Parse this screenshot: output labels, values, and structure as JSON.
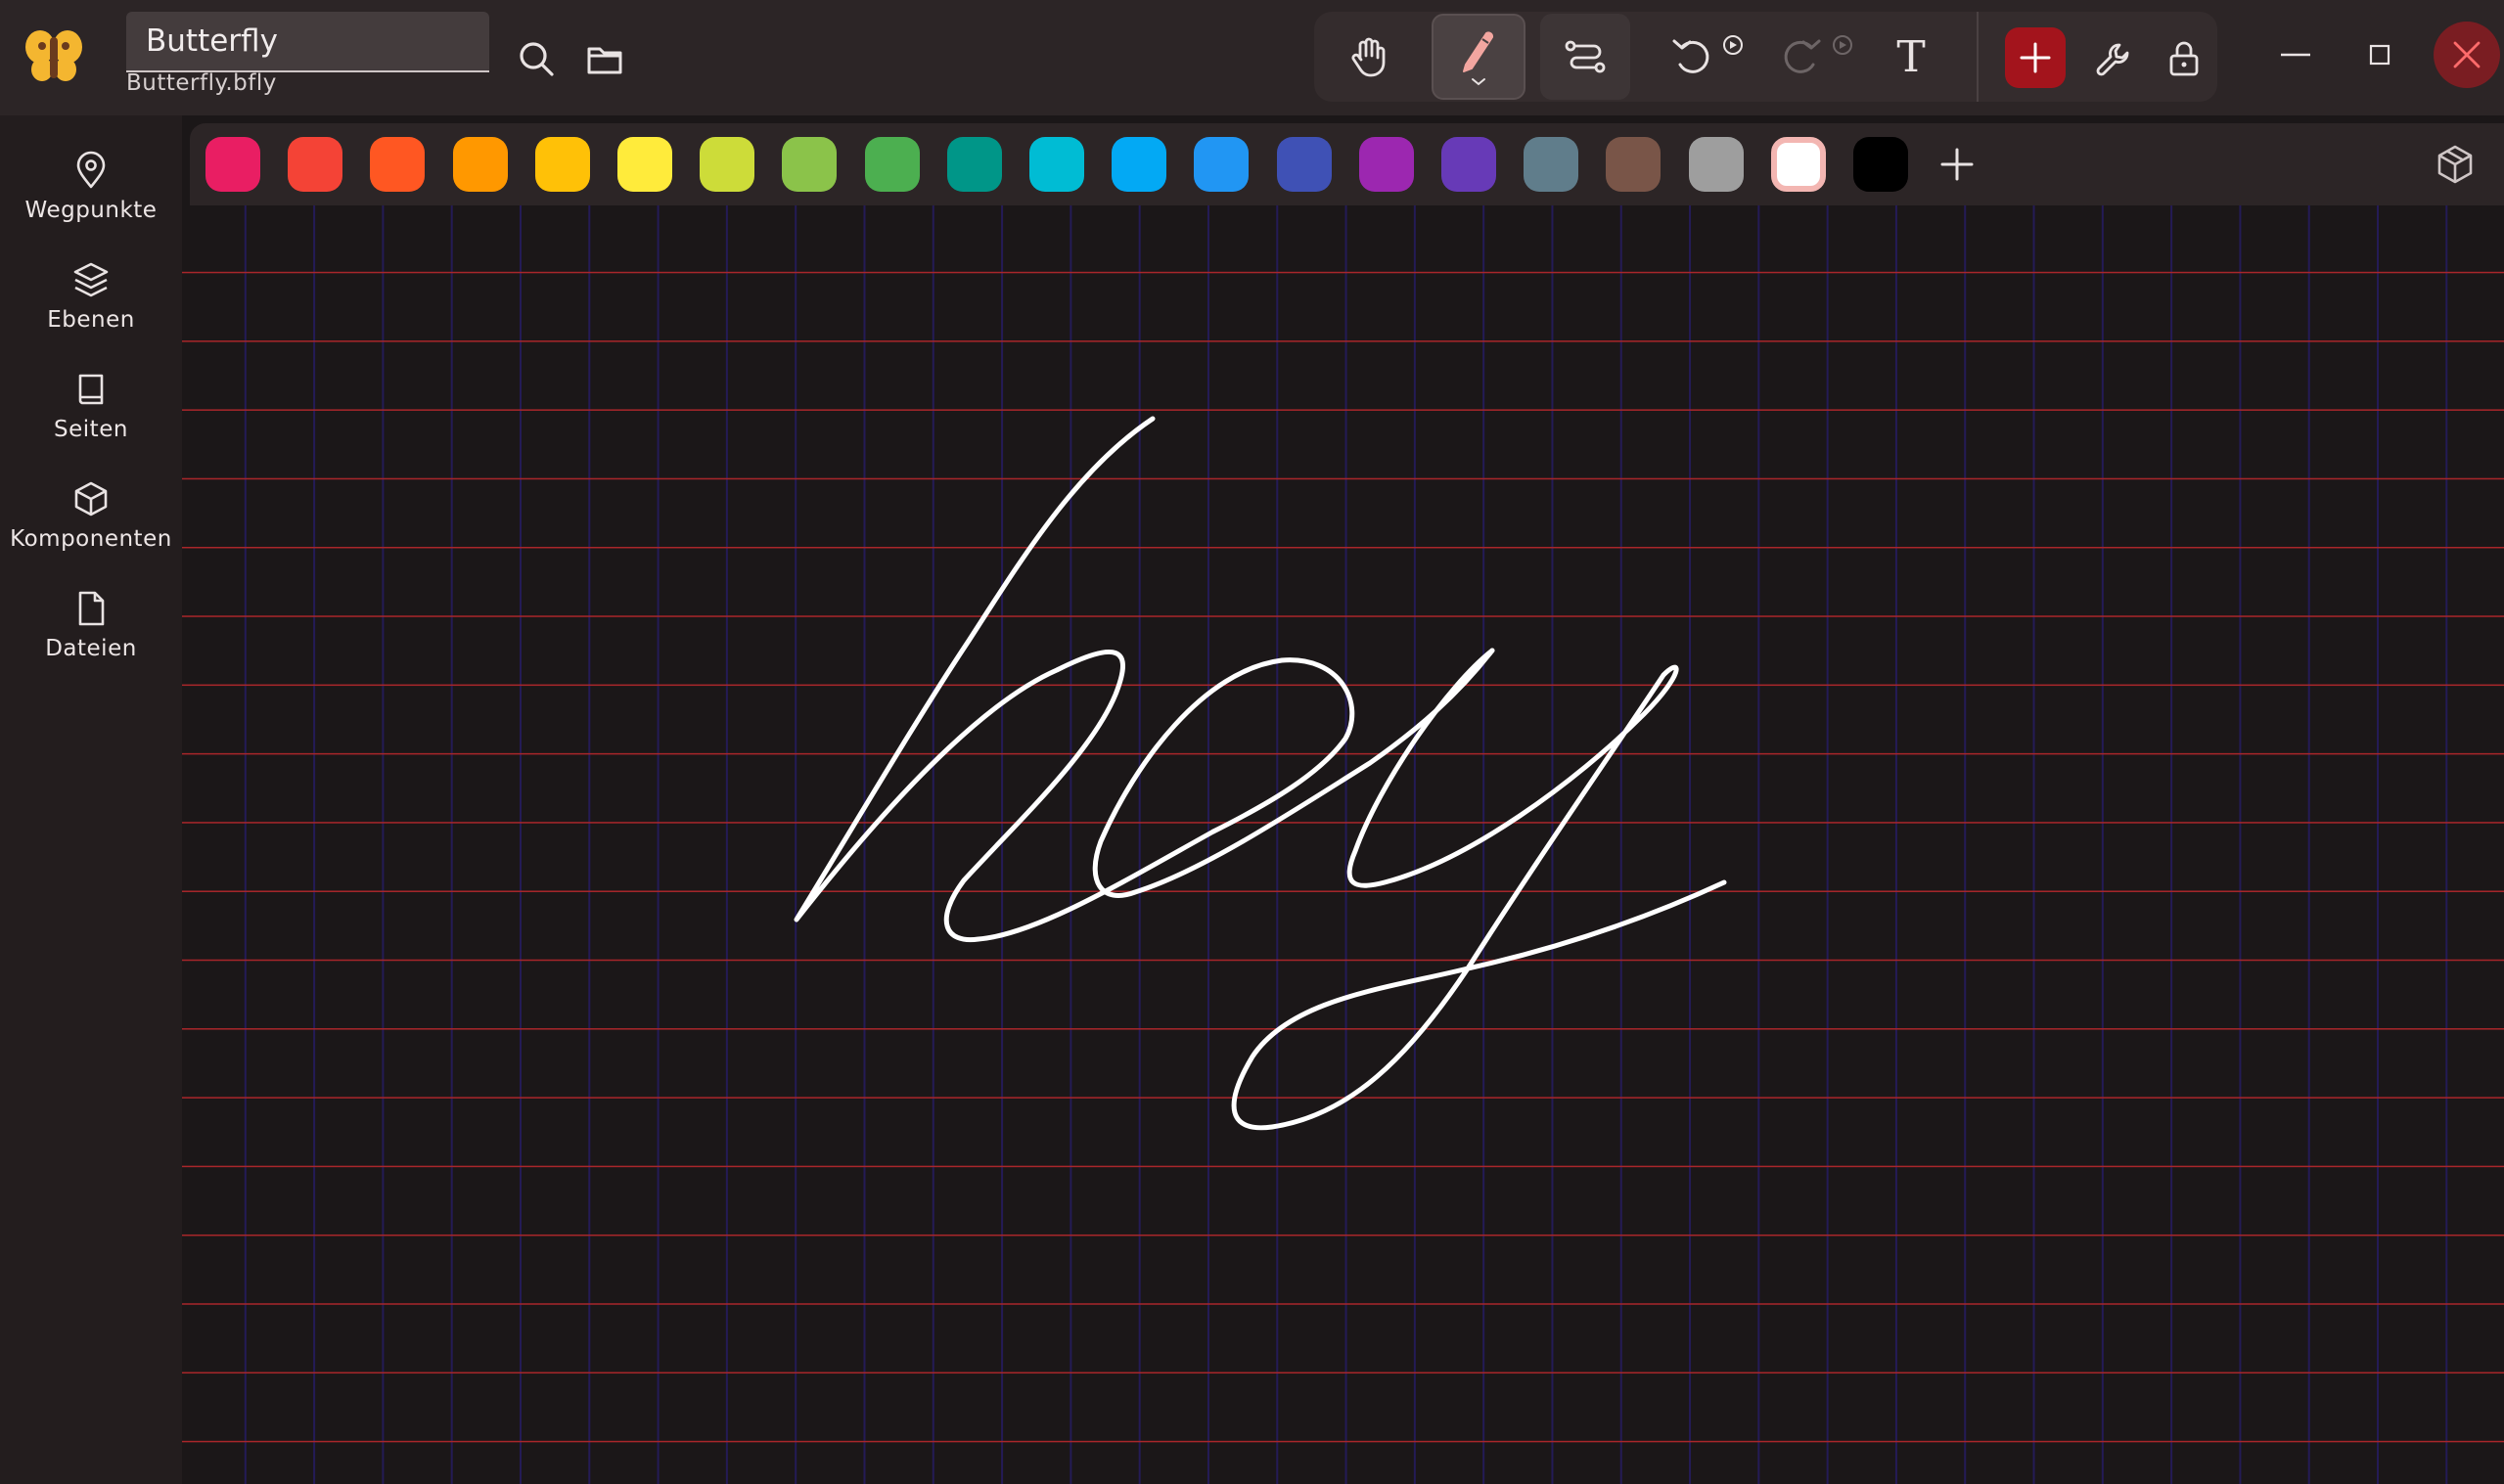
{
  "header": {
    "title_value": "Butterfly",
    "filename": "Butterfly.bfly"
  },
  "sidebar": {
    "items": [
      {
        "label": "Wegpunkte",
        "icon": "location-pin-icon"
      },
      {
        "label": "Ebenen",
        "icon": "layers-icon"
      },
      {
        "label": "Seiten",
        "icon": "book-icon"
      },
      {
        "label": "Komponenten",
        "icon": "cube-icon"
      },
      {
        "label": "Dateien",
        "icon": "file-icon"
      }
    ]
  },
  "toolbar": {
    "tools": [
      "hand-icon",
      "pen-icon",
      "path-icon",
      "undo-icon",
      "redo-icon",
      "text-icon"
    ],
    "text_tool_glyph": "T",
    "active_tool": "pen"
  },
  "palette": {
    "colors": [
      "#e91e63",
      "#f44336",
      "#ff5722",
      "#ff9800",
      "#ffc107",
      "#ffeb3b",
      "#cddc39",
      "#8bc34a",
      "#4caf50",
      "#009688",
      "#00bcd4",
      "#03a9f4",
      "#2196f3",
      "#3f51b5",
      "#9c27b0",
      "#673ab7",
      "#607d8b",
      "#795548",
      "#9e9e9e",
      "#ffffff",
      "#000000"
    ],
    "selected": "#ffffff"
  },
  "theme": {
    "accent": "#a3141c",
    "grid_line": "#a9262a",
    "grid_column": "#241b56",
    "ink": "#ffffff"
  }
}
